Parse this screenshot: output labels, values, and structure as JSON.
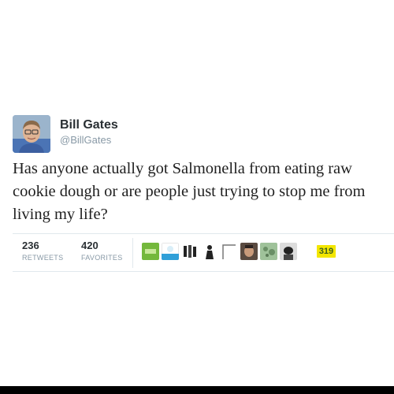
{
  "tweet": {
    "author": {
      "display_name": "Bill Gates",
      "handle": "@BillGates"
    },
    "text": "Has anyone actually got Salmonella from eating raw cookie dough or are people just trying to stop me from living my life?",
    "retweets": {
      "count": "236",
      "label": "RETWEETS"
    },
    "favorites": {
      "count": "420",
      "label": "FAVORITES"
    },
    "favoriters_more": "319"
  },
  "colors": {
    "name": "#292f33",
    "muted": "#8899a6",
    "divider": "#e1e8ed"
  }
}
